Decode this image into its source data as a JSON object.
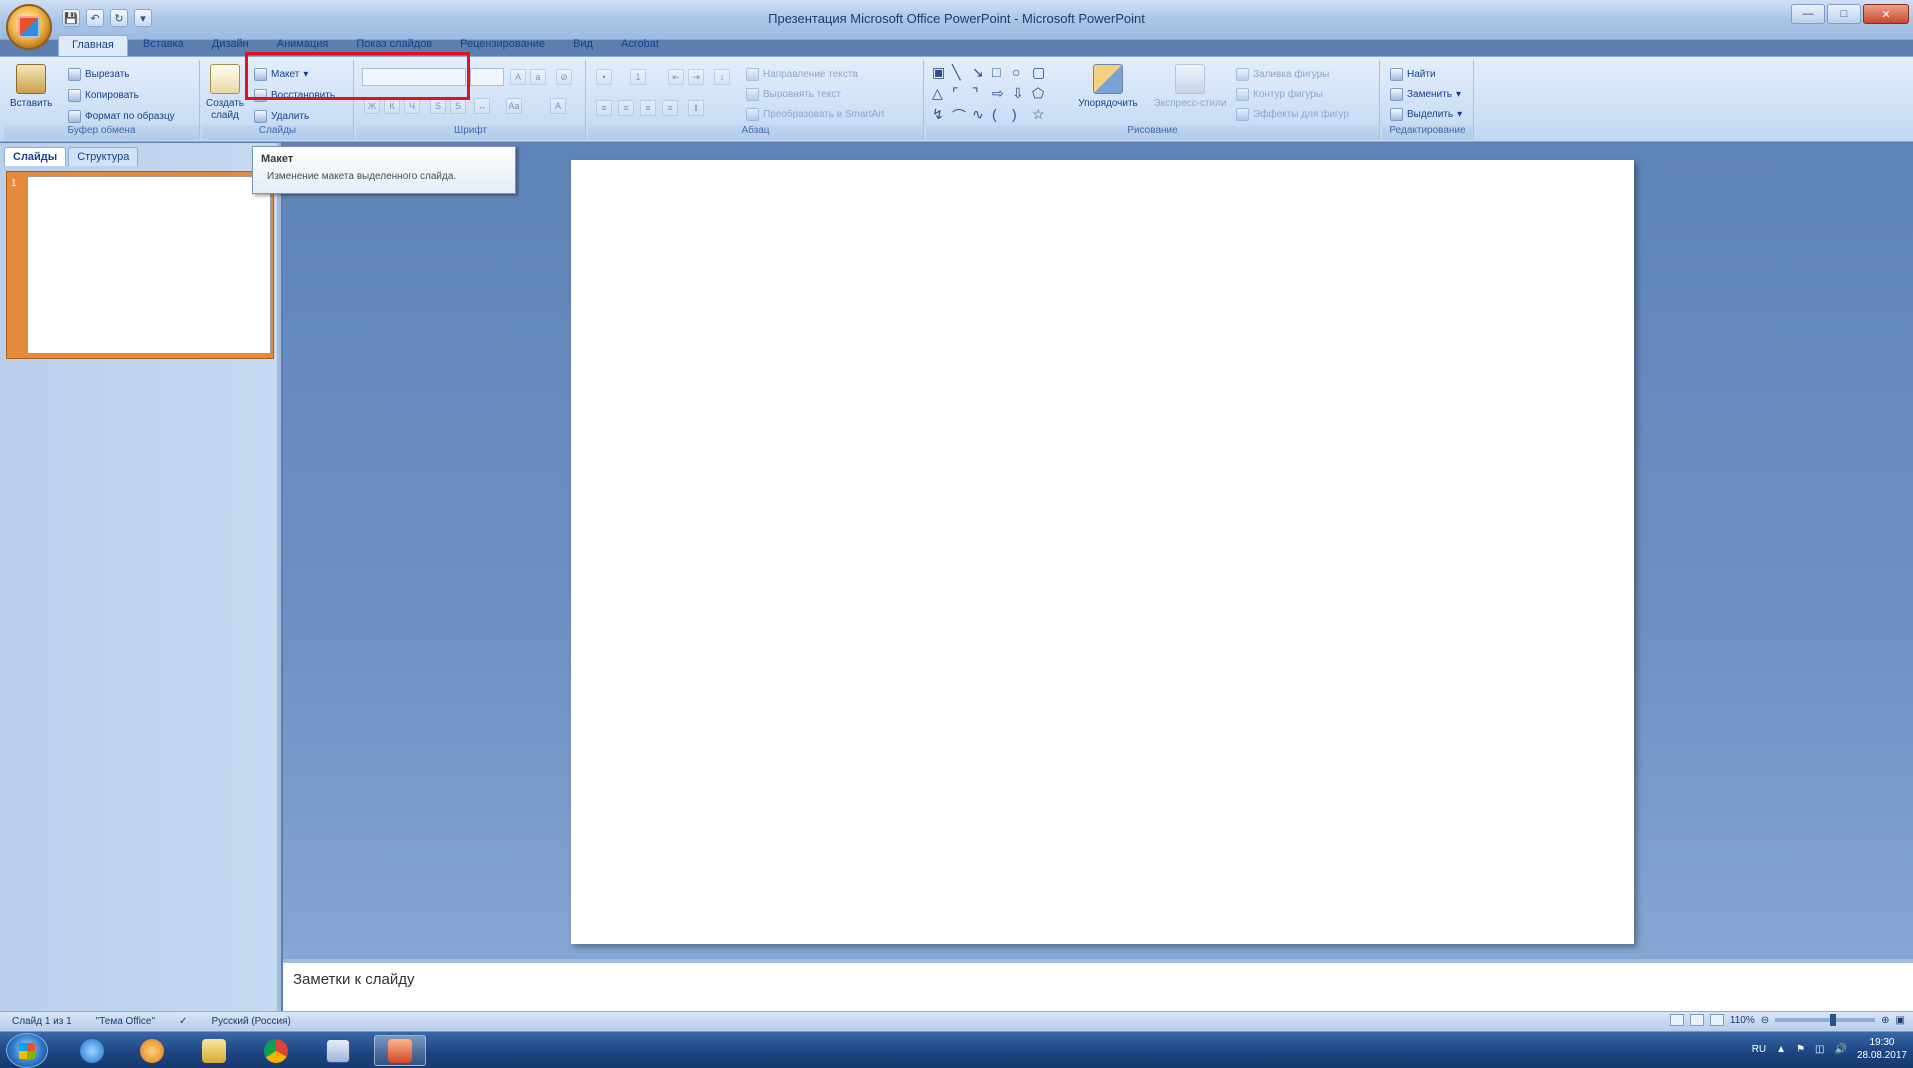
{
  "window": {
    "title": "Презентация Microsoft Office PowerPoint - Microsoft PowerPoint"
  },
  "ribbon": {
    "tabs": [
      "Главная",
      "Вставка",
      "Дизайн",
      "Анимация",
      "Показ слайдов",
      "Рецензирование",
      "Вид",
      "Acrobat"
    ],
    "clipboard": {
      "paste": "Вставить",
      "cut": "Вырезать",
      "copy": "Копировать",
      "format_painter": "Формат по образцу",
      "group_label": "Буфер обмена"
    },
    "slides": {
      "new_slide": "Создать слайд",
      "layout": "Макет",
      "reset": "Восстановить",
      "delete": "Удалить",
      "group_label": "Слайды"
    },
    "font": {
      "group_label": "Шрифт"
    },
    "paragraph": {
      "text_direction": "Направление текста",
      "align_text": "Выровнять текст",
      "convert_smartart": "Преобразовать в SmartArt",
      "group_label": "Абзац"
    },
    "drawing": {
      "arrange": "Упорядочить",
      "quick_styles": "Экспресс-стили",
      "shape_fill": "Заливка фигуры",
      "shape_outline": "Контур фигуры",
      "shape_effects": "Эффекты для фигур",
      "group_label": "Рисование"
    },
    "editing": {
      "find": "Найти",
      "replace": "Заменить",
      "select": "Выделить",
      "group_label": "Редактирование"
    }
  },
  "tooltip": {
    "title": "Макет",
    "description": "Изменение макета выделенного слайда."
  },
  "left_pane": {
    "tabs": [
      "Слайды",
      "Структура"
    ],
    "slide_number": "1"
  },
  "notes": {
    "placeholder": "Заметки к слайду"
  },
  "status_bar": {
    "slide_info": "Слайд 1 из 1",
    "theme": "\"Тема Office\"",
    "language": "Русский (Россия)",
    "zoom": "110%"
  },
  "taskbar": {
    "language": "RU",
    "time": "19:30",
    "date": "28.08.2017"
  },
  "colors": {
    "highlight": "#e0121b",
    "ribbon_text": "#15428b"
  }
}
